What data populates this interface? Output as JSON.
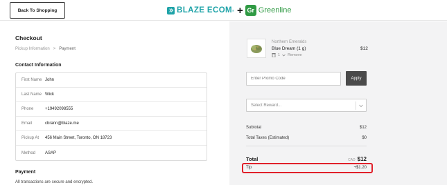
{
  "header": {
    "back_label": "Back To Shopping",
    "brand_name": "BLAZE ECOM",
    "brand_mark": "®",
    "plus": "+",
    "partner_badge": "Gr",
    "partner_name": "Greenline",
    "brand_color": "#1fa3a8",
    "partner_color": "#2f9a43"
  },
  "checkout": {
    "title": "Checkout",
    "breadcrumb": {
      "step1": "Pickup Information",
      "separator": ">",
      "step2": "Payment"
    },
    "contact_title": "Contact Information",
    "contact_rows": [
      {
        "label": "First Name",
        "value": "John"
      },
      {
        "label": "Last Name",
        "value": "Wick"
      },
      {
        "label": "Phone",
        "value": "+19492098555"
      },
      {
        "label": "Email",
        "value": "cbrann@blaze.me"
      },
      {
        "label": "Pickup At",
        "value": "456 Main Street, Toronto, ON 18723"
      },
      {
        "label": "Method",
        "value": "ASAP"
      }
    ],
    "payment_title": "Payment",
    "payment_subtitle": "All transactions are secure and encrypted."
  },
  "cart": {
    "item": {
      "brand": "Northern Emeralds",
      "name": "Blue Dream (1 g)",
      "qty": "1",
      "remove_label": "Remove",
      "price": "$12"
    },
    "promo_placeholder": "Enter Promo Code",
    "apply_label": "Apply",
    "reward_placeholder": "Select Reward...",
    "subtotal_label": "Subtotal",
    "subtotal_value": "$12",
    "taxes_label": "Total Taxes (Estimated)",
    "taxes_value": "$0",
    "total_label": "Total",
    "currency": "CAD",
    "total_value": "$12",
    "tip_label": "Tip",
    "tip_value": "+$1.20",
    "highlight_color": "#e0202a"
  }
}
